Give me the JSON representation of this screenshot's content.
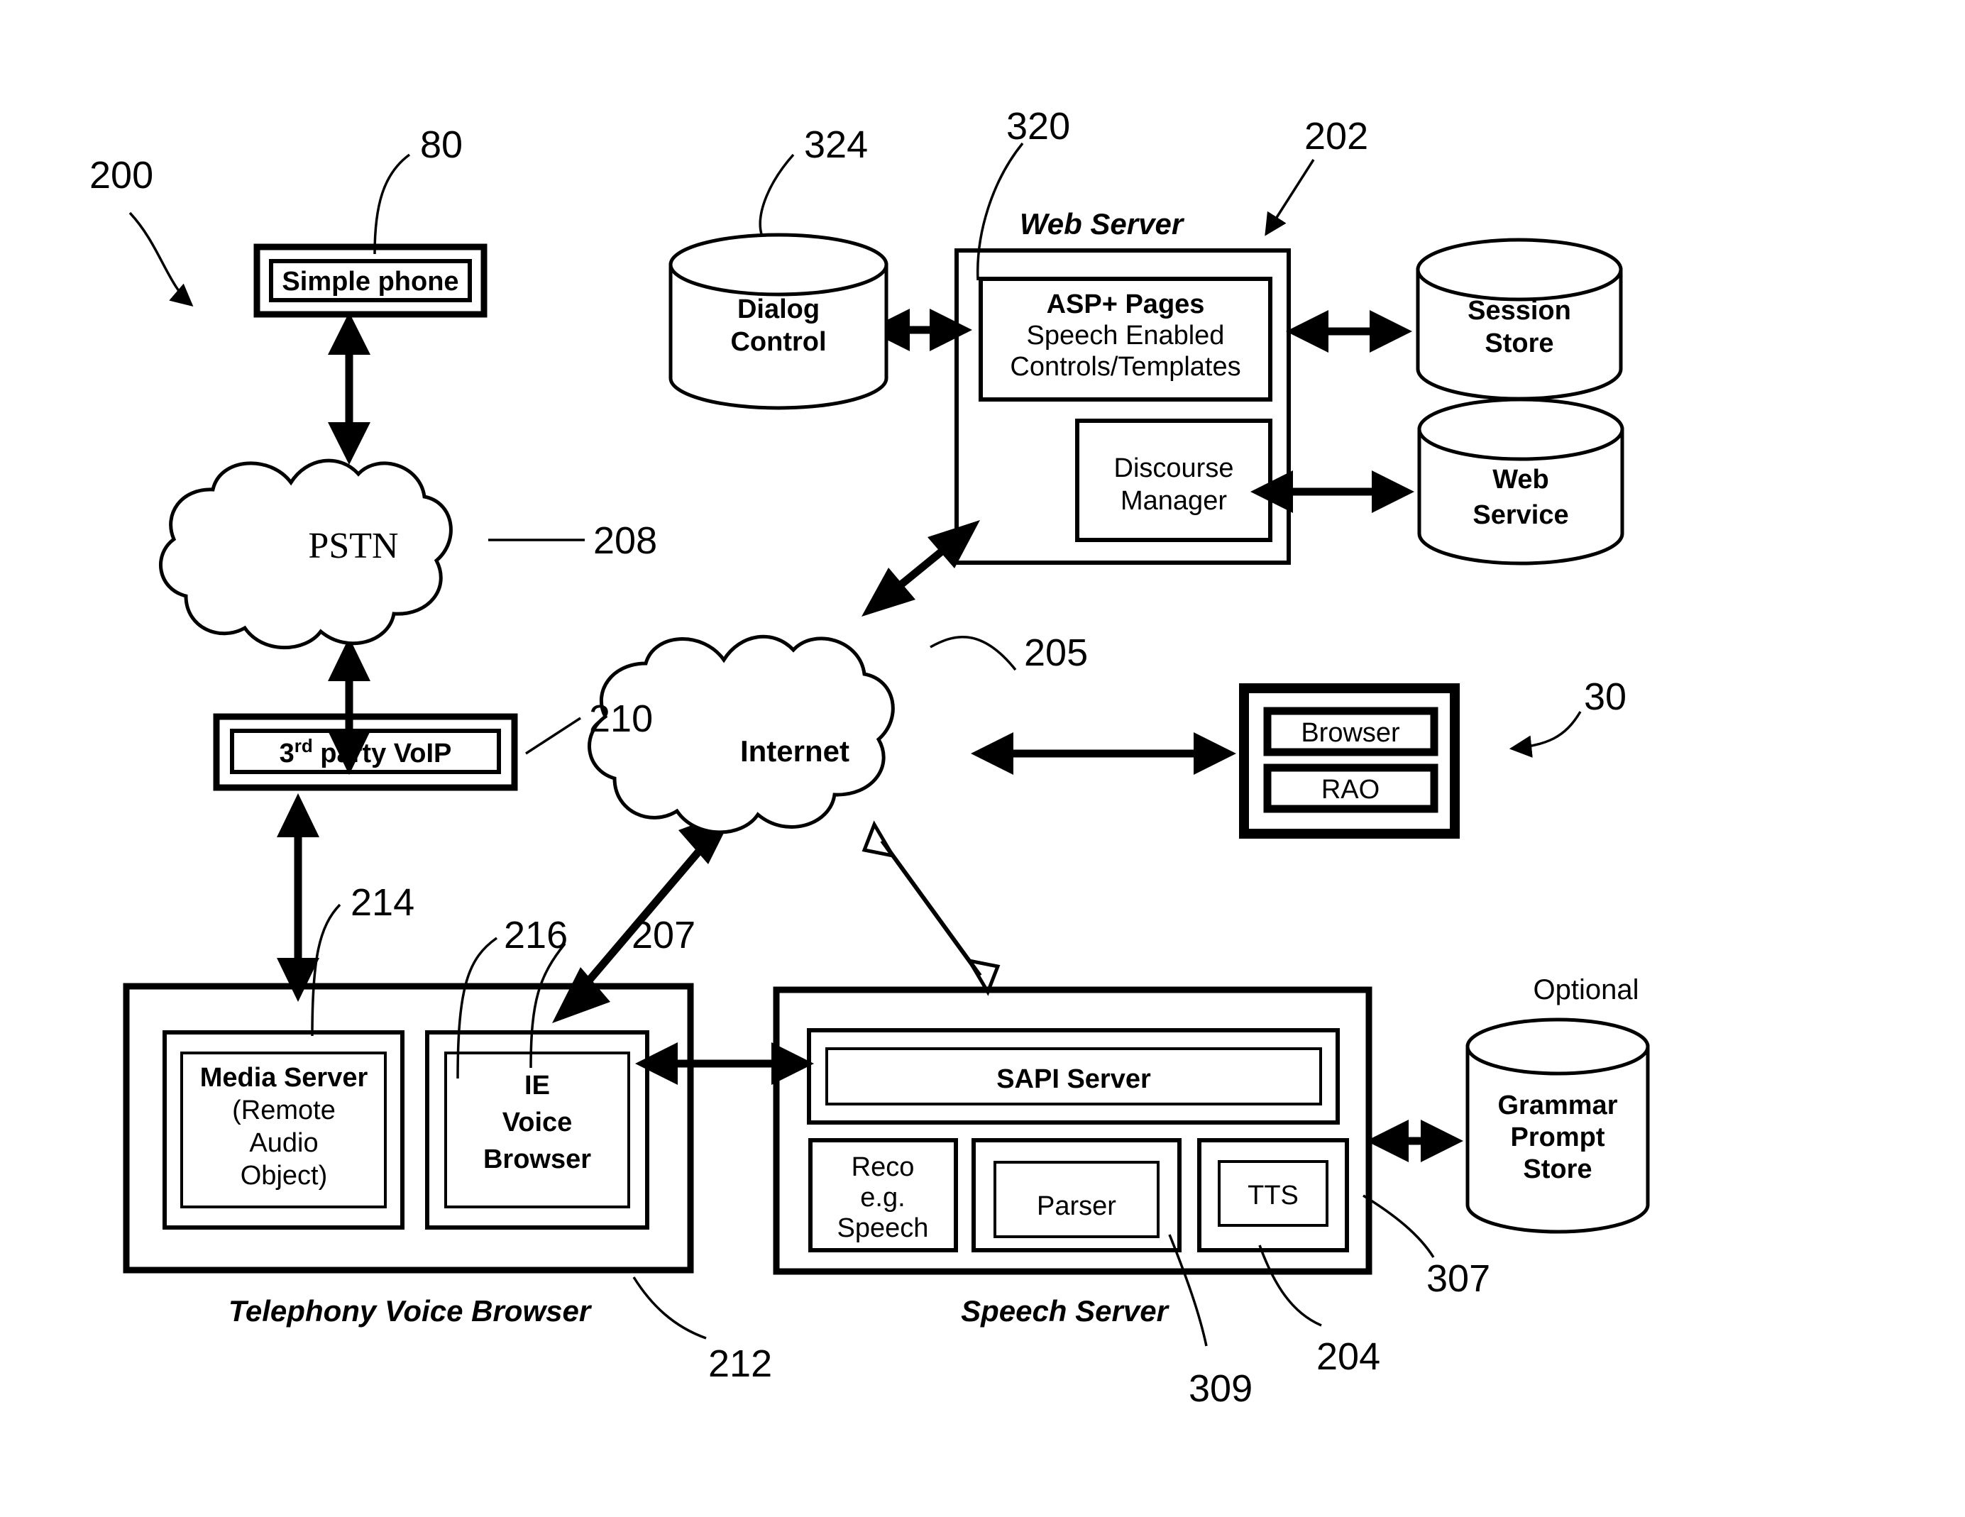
{
  "figure": {
    "ref_main": "200",
    "refs": {
      "phone": "80",
      "pstn": "208",
      "voip": "210",
      "web_server": "202",
      "asp_pages": "320",
      "dialog_control": "324",
      "internet": "205",
      "client_device": "30",
      "media_server": "214",
      "ie_voice_browser": "216",
      "link_207": "207",
      "telephony_voice_browser": "212",
      "speech_server_204": "204",
      "reco_309": "309",
      "tts_307": "307"
    }
  },
  "nodes": {
    "simple_phone": {
      "label": "Simple phone"
    },
    "pstn": {
      "label": "PSTN"
    },
    "voip": {
      "label_pre": "3",
      "label_sup": "rd",
      "label_post": " party VoIP",
      "label_full": "3rd party VoIP"
    },
    "dialog_control": {
      "line1": "Dialog",
      "line2": "Control"
    },
    "web_server": {
      "caption": "Web Server"
    },
    "asp_pages": {
      "line1": "ASP+ Pages",
      "line2": "Speech Enabled",
      "line3": "Controls/Templates"
    },
    "discourse_manager": {
      "line1": "Discourse",
      "line2": "Manager"
    },
    "session_store": {
      "line1": "Session",
      "line2": "Store"
    },
    "web_service": {
      "line1": "Web",
      "line2": "Service"
    },
    "internet": {
      "label": "Internet"
    },
    "client": {
      "browser": "Browser",
      "rao": "RAO"
    },
    "media_server": {
      "line1": "Media Server",
      "line2": "(Remote",
      "line3": "Audio",
      "line4": "Object)"
    },
    "ie_voice_browser": {
      "line1": "IE",
      "line2": "Voice",
      "line3": "Browser"
    },
    "telephony_voice_browser": {
      "caption": "Telephony Voice Browser"
    },
    "sapi_server": {
      "label": "SAPI Server"
    },
    "reco": {
      "line1": "Reco",
      "line2": "e.g.",
      "line3": "Speech"
    },
    "parser": {
      "label": "Parser"
    },
    "tts": {
      "label": "TTS"
    },
    "speech_server": {
      "caption": "Speech Server"
    },
    "grammar_prompt_store": {
      "line1": "Grammar",
      "line2": "Prompt",
      "line3": "Store",
      "note": "Optional"
    }
  },
  "colors": {
    "stroke": "#000000",
    "background": "#ffffff"
  }
}
